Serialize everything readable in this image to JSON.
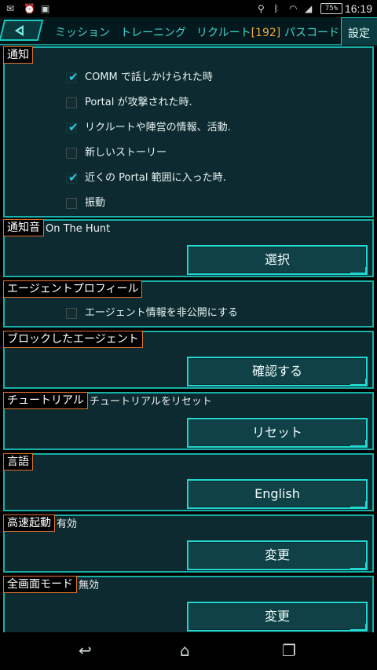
{
  "status_bar": {
    "left_icons": [
      "mail-icon",
      "alarm-icon",
      "clipboard-icon"
    ],
    "right_icons": [
      "location-icon",
      "bluetooth-icon",
      "wifi-icon",
      "signal-icon"
    ],
    "battery": "75%",
    "time": "16:19"
  },
  "top_nav": {
    "back_icon": "back-arrow-icon",
    "tabs": [
      {
        "label": "ミッション"
      },
      {
        "label": "トレーニング"
      },
      {
        "label": "リクルート",
        "count": "[192]"
      },
      {
        "label": "パスコード"
      }
    ],
    "active_tab": "設定"
  },
  "notifications": {
    "title": "通知",
    "items": [
      {
        "label": "COMM で話しかけられた時",
        "checked": true
      },
      {
        "label": "Portal が攻撃された時.",
        "checked": false
      },
      {
        "label": "リクルートや陣営の情報、活動.",
        "checked": true
      },
      {
        "label": "新しいストーリー",
        "checked": false
      },
      {
        "label": "近くの Portal 範囲に入った時.",
        "checked": true
      },
      {
        "label": "振動",
        "checked": false
      }
    ]
  },
  "sound": {
    "title": "通知音",
    "value": "On The Hunt",
    "button": "選択"
  },
  "profile": {
    "title": "エージェントプロフィール",
    "item": {
      "label": "エージェント情報を非公開にする",
      "checked": false
    }
  },
  "blocked": {
    "title": "ブロックしたエージェント",
    "button": "確認する"
  },
  "tutorial": {
    "title": "チュートリアル",
    "value": "チュートリアルをリセット",
    "button": "リセット"
  },
  "language": {
    "title": "言語",
    "button": "English"
  },
  "fast_boot": {
    "title": "高速起動",
    "value": "有効",
    "button": "変更"
  },
  "fullscreen": {
    "title": "全画面モード",
    "value": "無効",
    "button": "変更"
  },
  "nav_bar": {
    "icons": [
      "back-icon",
      "home-icon",
      "recent-apps-icon"
    ]
  },
  "colors": {
    "accent": "#22d7cf",
    "title_border": "#e0712a",
    "panel": "#0c2a2f",
    "count": "#f0a83a"
  }
}
